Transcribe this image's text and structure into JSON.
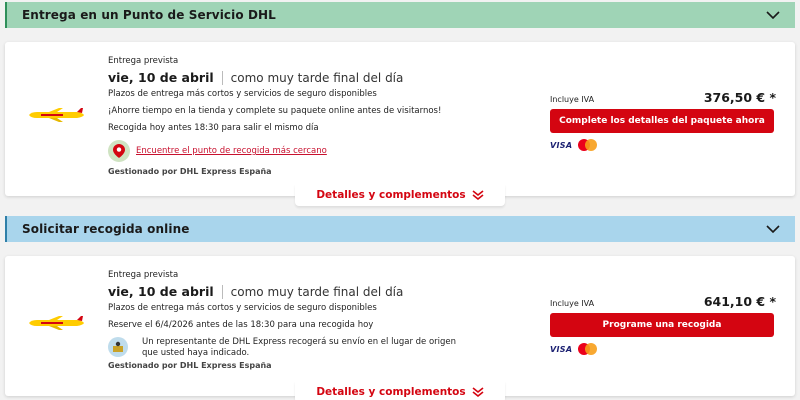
{
  "colors": {
    "accent": "#d40511",
    "green_bar": "#9fd4b6",
    "blue_bar": "#a9d5ec"
  },
  "section1": {
    "title": "Entrega en un Punto de Servicio DHL",
    "card": {
      "expected_label": "Entrega prevista",
      "date": "vie, 10 de abril",
      "latest": "como muy tarde final del día",
      "line1": "Plazos de entrega más cortos y servicios de seguro disponibles",
      "line2": "¡Ahorre tiempo en la tienda y complete su paquete online antes de visitarnos!",
      "line3": "Recogida hoy antes 18:30 para salir el mismo día",
      "point_link": "Encuentre el punto de recogida más cercano",
      "managed_by": "Gestionado por DHL Express España",
      "vat_label": "Incluye IVA",
      "price": "376,50 € *",
      "button": "Complete los detalles del paquete ahora",
      "payment_methods": [
        "VISA",
        "Mastercard"
      ],
      "details": "Detalles y complementos"
    }
  },
  "section2": {
    "title": "Solicitar recogida online",
    "card": {
      "expected_label": "Entrega prevista",
      "date": "vie, 10 de abril",
      "latest": "como muy tarde final del día",
      "line1": "Plazos de entrega más cortos y servicios de seguro disponibles",
      "line2": "Reserve el 6/4/2026 antes de las 18:30 para una recogida hoy",
      "courier_text": "Un representante de DHL Express recogerá su envío en el lugar de origen que usted haya indicado.",
      "managed_by": "Gestionado por DHL Express España",
      "vat_label": "Incluye IVA",
      "price": "641,10 € *",
      "button": "Programe una recogida",
      "payment_methods": [
        "VISA",
        "Mastercard"
      ],
      "details": "Detalles y complementos"
    }
  },
  "icons": [
    "chevron-down-icon",
    "dhl-plane-icon",
    "map-pin-icon",
    "courier-icon",
    "visa-icon",
    "mastercard-icon",
    "double-chevron-down-icon"
  ]
}
